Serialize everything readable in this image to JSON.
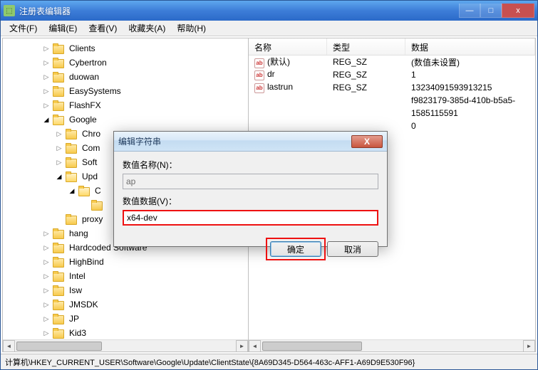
{
  "window": {
    "title": "注册表编辑器",
    "min": "—",
    "max": "□",
    "close": "x"
  },
  "menu": {
    "file": "文件(F)",
    "edit": "编辑(E)",
    "view": "查看(V)",
    "fav": "收藏夹(A)",
    "help": "帮助(H)"
  },
  "tree": {
    "items": [
      {
        "indent": 3,
        "exp": "▷",
        "label": "Clients"
      },
      {
        "indent": 3,
        "exp": "▷",
        "label": "Cybertron"
      },
      {
        "indent": 3,
        "exp": "▷",
        "label": "duowan"
      },
      {
        "indent": 3,
        "exp": "▷",
        "label": "EasySystems"
      },
      {
        "indent": 3,
        "exp": "▷",
        "label": "FlashFX"
      },
      {
        "indent": 3,
        "exp": "▷",
        "label": "Google",
        "open": true,
        "expsym": "◢",
        "sel": false
      },
      {
        "indent": 4,
        "exp": "▷",
        "label": "Chro"
      },
      {
        "indent": 4,
        "exp": "▷",
        "label": "Com"
      },
      {
        "indent": 4,
        "exp": "▷",
        "label": "Soft"
      },
      {
        "indent": 4,
        "exp": "▷",
        "label": "Upd",
        "open": true,
        "expsym": "◢"
      },
      {
        "indent": 5,
        "exp": "▷",
        "label": "C",
        "open": true,
        "expsym": "◢"
      },
      {
        "indent": 6,
        "exp": "",
        "label": ""
      },
      {
        "indent": 4,
        "exp": "",
        "label": "proxy"
      },
      {
        "indent": 3,
        "exp": "▷",
        "label": "hang"
      },
      {
        "indent": 3,
        "exp": "▷",
        "label": "Hardcoded Software"
      },
      {
        "indent": 3,
        "exp": "▷",
        "label": "HighBind"
      },
      {
        "indent": 3,
        "exp": "▷",
        "label": "Intel"
      },
      {
        "indent": 3,
        "exp": "▷",
        "label": "Isw"
      },
      {
        "indent": 3,
        "exp": "▷",
        "label": "JMSDK"
      },
      {
        "indent": 3,
        "exp": "▷",
        "label": "JP"
      },
      {
        "indent": 3,
        "exp": "▷",
        "label": "Kid3"
      }
    ]
  },
  "list": {
    "headers": {
      "name": "名称",
      "type": "类型",
      "data": "数据"
    },
    "rows": [
      {
        "name": "(默认)",
        "type": "REG_SZ",
        "data": "(数值未设置)"
      },
      {
        "name": "dr",
        "type": "REG_SZ",
        "data": "1"
      },
      {
        "name": "lastrun",
        "type": "REG_SZ",
        "data": "13234091593913215"
      },
      {
        "name": "",
        "type": "",
        "data": "f9823179-385d-410b-b5a5-"
      },
      {
        "name": "",
        "type": "",
        "data": "1585115591"
      },
      {
        "name": "",
        "type": "",
        "data": "0"
      }
    ]
  },
  "dialog": {
    "title": "编辑字符串",
    "name_label": "数值名称(N)：",
    "name_value": "ap",
    "data_label": "数值数据(V)：",
    "data_value": "x64-dev",
    "ok": "确定",
    "cancel": "取消",
    "close": "X"
  },
  "statusbar": "计算机\\HKEY_CURRENT_USER\\Software\\Google\\Update\\ClientState\\{8A69D345-D564-463c-AFF1-A69D9E530F96}"
}
